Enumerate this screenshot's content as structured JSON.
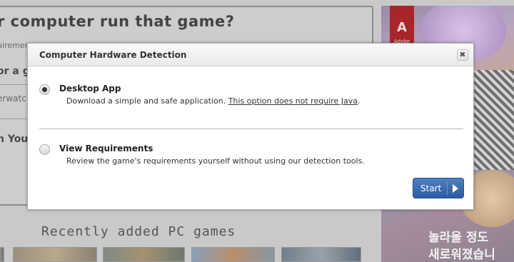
{
  "background": {
    "heading": "r computer run that game?",
    "fragments": [
      "uiremen",
      "or a g",
      "erwatc",
      "n You"
    ],
    "recent_title": "Recently added PC games",
    "thumbnails": [
      "",
      "",
      "",
      "",
      ""
    ]
  },
  "ad": {
    "logo_letter": "A",
    "logo_text": "Adobe",
    "text_line1": "놀라울 정도",
    "text_line2": "새로워졌습니"
  },
  "modal": {
    "title": "Computer Hardware Detection",
    "close_symbol": "✖",
    "options": [
      {
        "title": "Desktop App",
        "description": "Download a simple and safe application.",
        "link": "This option does not require Java",
        "suffix": ".",
        "selected": true
      },
      {
        "title": "View Requirements",
        "description": "Review the game's requirements yourself without using our detection tools.",
        "selected": false
      }
    ],
    "start_label": "Start",
    "start_color": "#3b6bb0"
  }
}
